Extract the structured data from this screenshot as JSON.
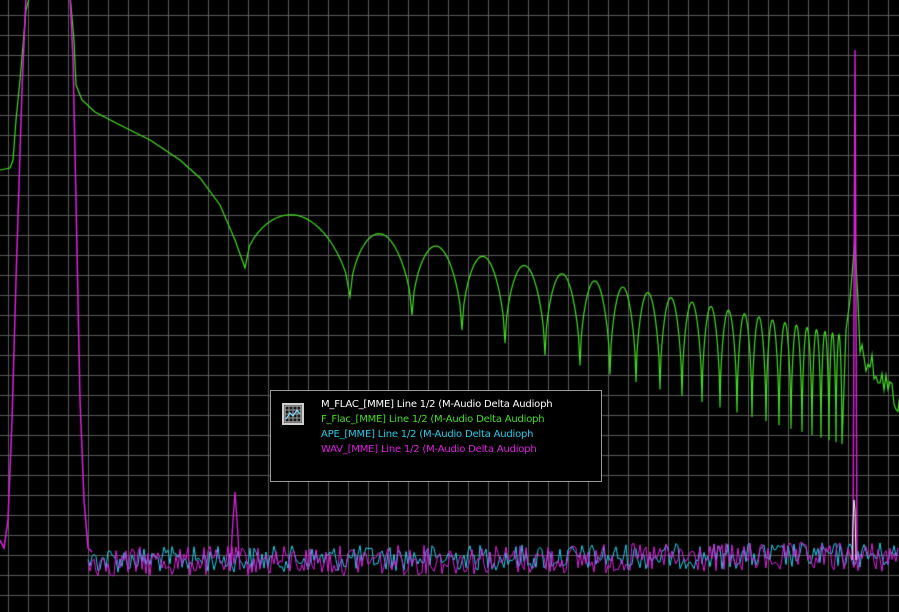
{
  "chart_data": {
    "type": "line",
    "title": "",
    "xlabel": "",
    "ylabel": "",
    "grid": true,
    "legend_placement": "bottom-center",
    "series": [
      {
        "name": "M_FLAC_[MME] Line 1/2 (M-Audio Delta Audioph",
        "color": "#ffffff"
      },
      {
        "name": "F_Flac_[MME] Line 1/2 (M-Audio Delta Audioph",
        "color": "#44dd22"
      },
      {
        "name": "APE_[MME] Line 1/2 (M-Audio Delta Audioph",
        "color": "#22cce6"
      },
      {
        "name": "WAV_[MME] Line 1/2 (M-Audio Delta Audioph",
        "color": "#dd22dd"
      }
    ]
  },
  "colors": {
    "background": "#000000",
    "grid": "#5a5a5a",
    "legend_border": "#9a9a9a"
  },
  "legend": {
    "icon": "grid-chart-icon"
  }
}
